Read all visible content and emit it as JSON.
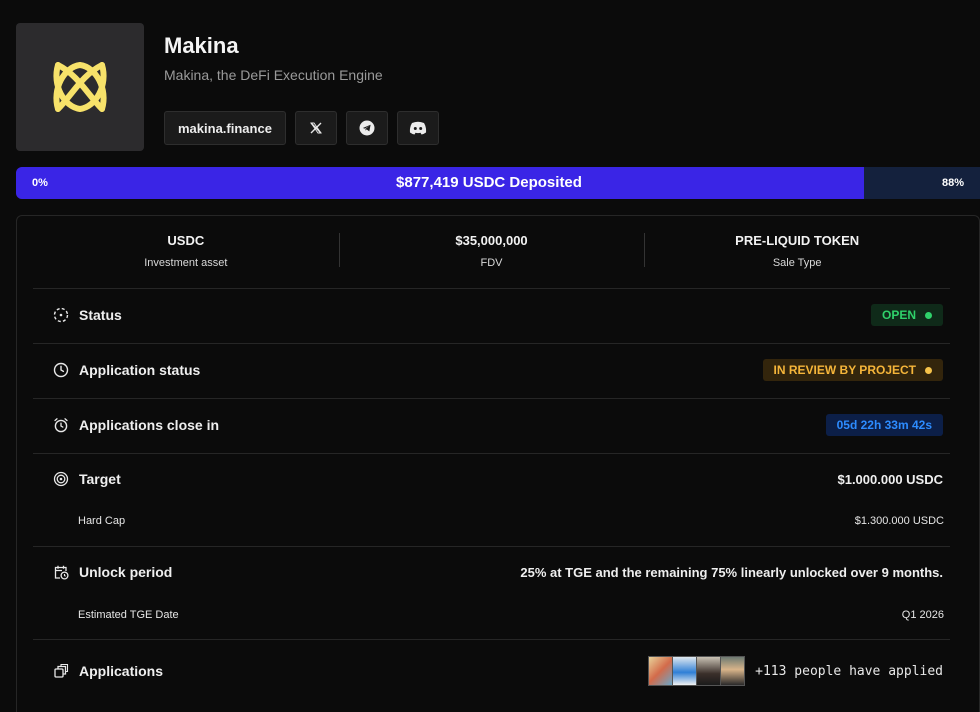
{
  "project": {
    "name": "Makina",
    "tagline": "Makina, the DeFi Execution Engine",
    "logo_icon": "makina-logo-icon",
    "logo_color": "#f7e26a",
    "links": {
      "website": "makina.finance",
      "x_icon": "x-icon",
      "telegram_icon": "telegram-icon",
      "discord_icon": "discord-icon"
    }
  },
  "progress": {
    "min_label": "0%",
    "deposited_label": "$877,419 USDC Deposited",
    "max_label": "88%",
    "fill_fraction": 0.88,
    "fill_color": "#3a25e6"
  },
  "stats": [
    {
      "value": "USDC",
      "label": "Investment asset"
    },
    {
      "value": "$35,000,000",
      "label": "FDV"
    },
    {
      "value": "PRE-LIQUID TOKEN",
      "label": "Sale Type"
    }
  ],
  "rows": {
    "status": {
      "label": "Status",
      "badge": "OPEN",
      "badge_color": "#2fd16a"
    },
    "application_status": {
      "label": "Application status",
      "badge": "IN REVIEW BY PROJECT",
      "badge_color": "#f5b53a"
    },
    "applications_close": {
      "label": "Applications close in",
      "countdown": "05d 22h 33m 42s",
      "badge_color": "#2d8cff"
    },
    "target": {
      "label": "Target",
      "value": "$1.000.000 USDC",
      "sub_label": "Hard Cap",
      "sub_value": "$1.300.000 USDC"
    },
    "unlock": {
      "label": "Unlock period",
      "value": "25% at TGE and the remaining 75% linearly unlocked over 9 months.",
      "sub_label": "Estimated TGE Date",
      "sub_value": "Q1 2026"
    },
    "applications": {
      "label": "Applications",
      "applied_text": "+113 people have applied"
    }
  }
}
